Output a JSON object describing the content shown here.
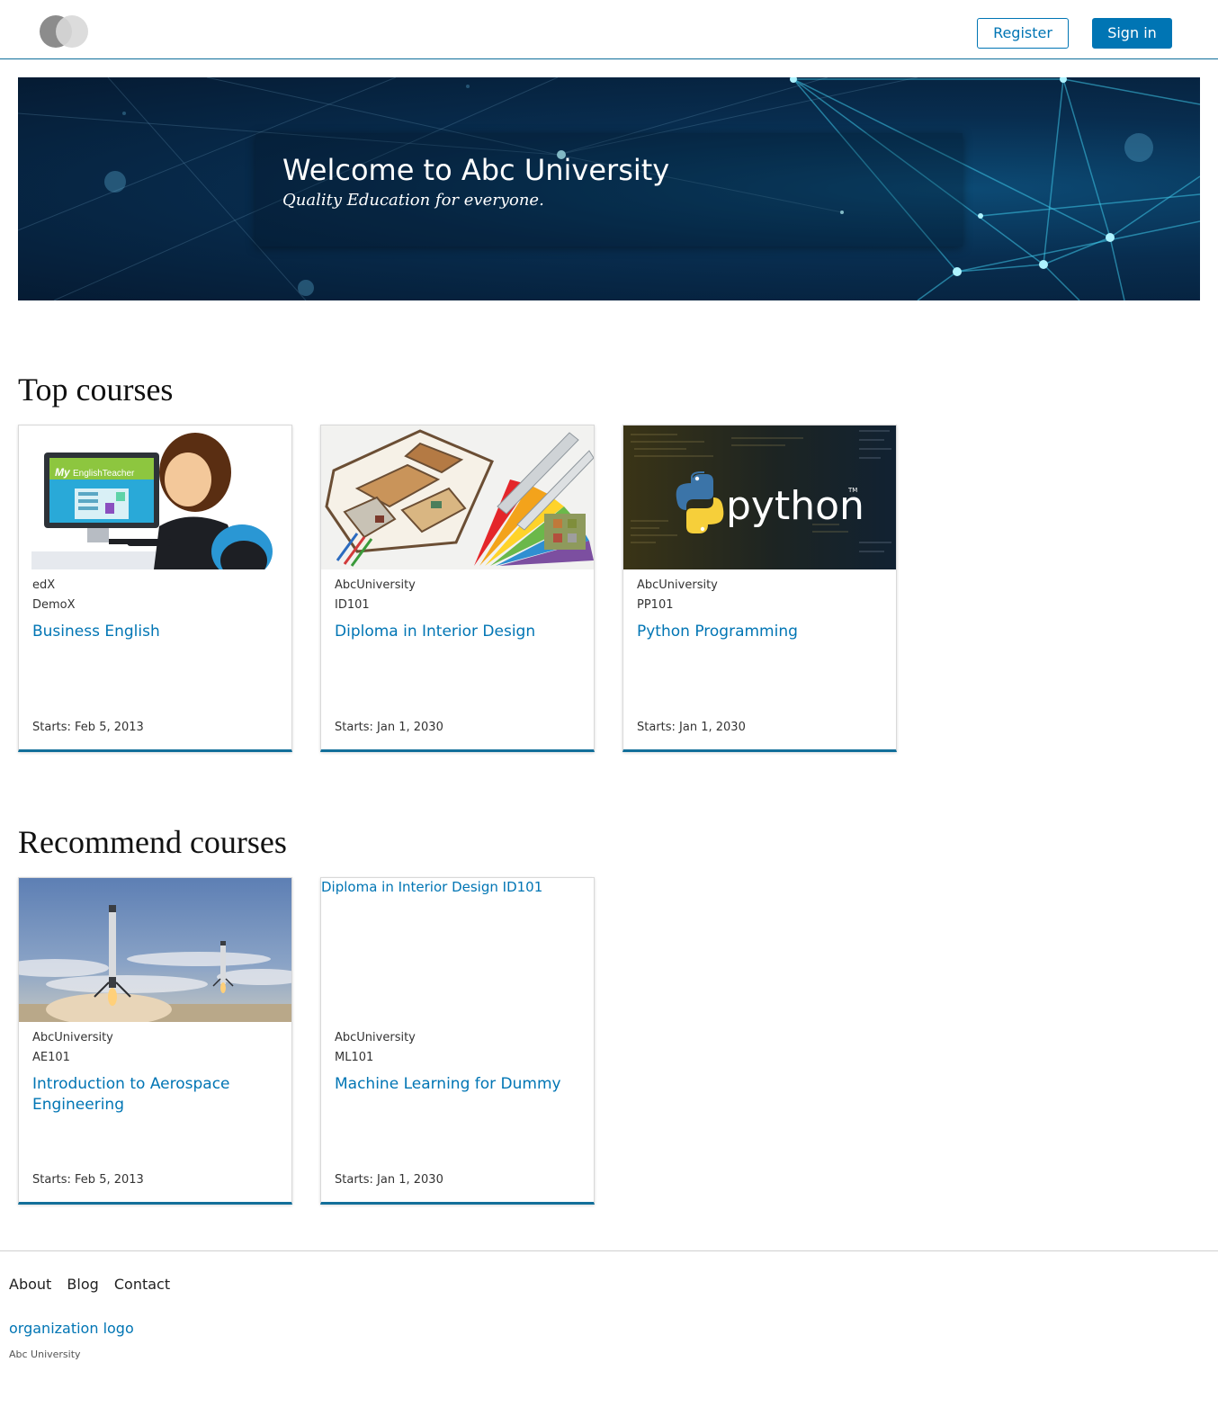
{
  "header": {
    "register_label": "Register",
    "signin_label": "Sign in"
  },
  "hero": {
    "title": "Welcome to Abc University",
    "subtitle": "Quality Education for everyone."
  },
  "top_courses": {
    "heading": "Top courses",
    "cards": [
      {
        "org": "edX",
        "code": "DemoX",
        "title": "Business English",
        "start": "Starts: Feb 5, 2013",
        "image": "english-teacher-illustration"
      },
      {
        "org": "AbcUniversity",
        "code": "ID101",
        "title": "Diploma in Interior Design",
        "start": "Starts: Jan 1, 2030",
        "image": "interior-floorplan"
      },
      {
        "org": "AbcUniversity",
        "code": "PP101",
        "title": "Python Programming",
        "start": "Starts: Jan 1, 2030",
        "image": "python-logo",
        "image_text": "python",
        "image_tm": "TM"
      }
    ]
  },
  "recommend_courses": {
    "heading": "Recommend courses",
    "cards": [
      {
        "org": "AbcUniversity",
        "code": "AE101",
        "title": "Introduction to Aerospace Engineering",
        "start": "Starts: Feb 5, 2013",
        "image": "rocket-landing"
      },
      {
        "org": "AbcUniversity",
        "code": "ML101",
        "title": "Machine Learning for Dummy",
        "start": "Starts: Jan 1, 2030",
        "image_alt": "Diploma in Interior Design ID101"
      }
    ]
  },
  "footer": {
    "links": [
      "About",
      "Blog",
      "Contact"
    ],
    "logo_alt": "organization logo",
    "copyright": "Abc University"
  },
  "colors": {
    "accent": "#0075b4",
    "card_border_bottom": "#126f9a",
    "header_rule": "#0f6e9b"
  }
}
